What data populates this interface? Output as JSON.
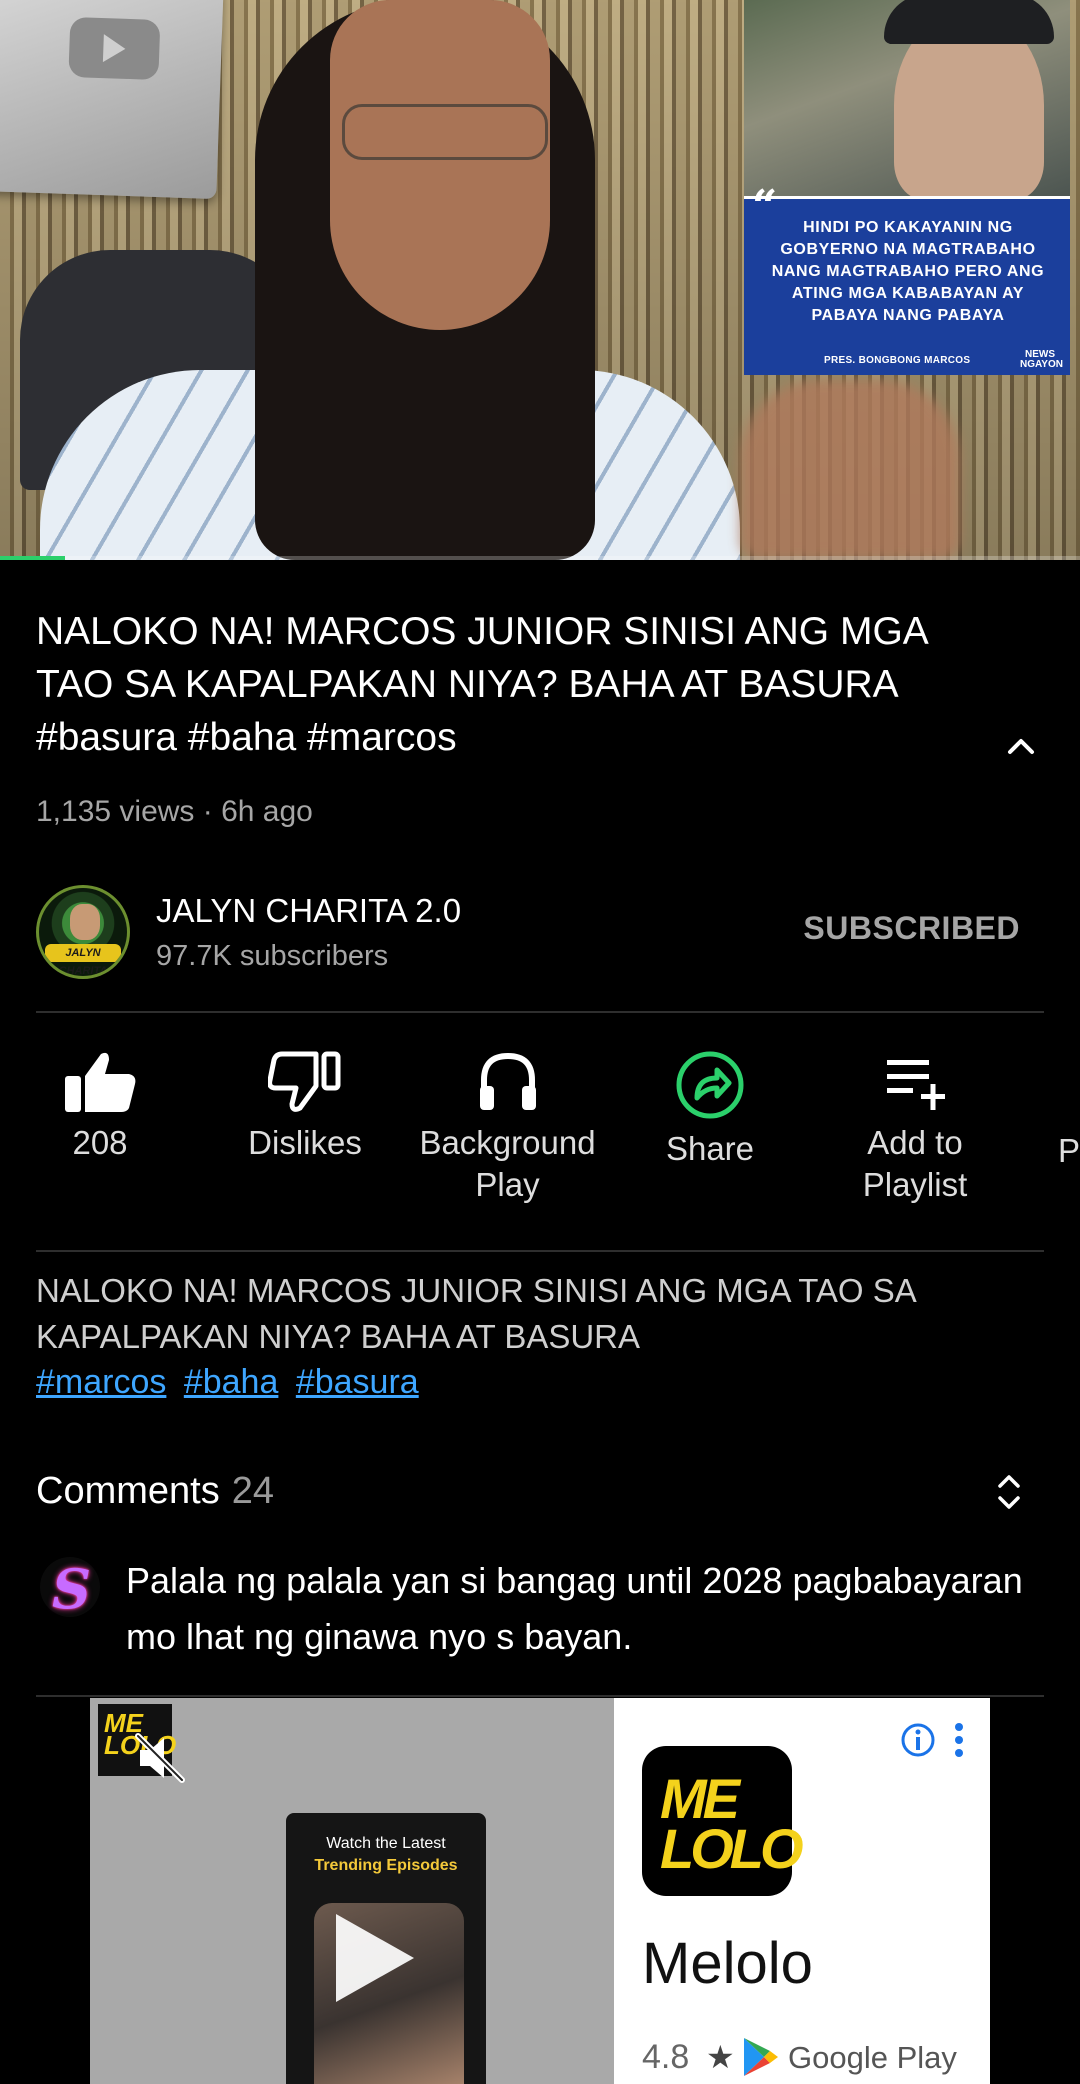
{
  "player": {
    "overlay_quote": "HINDI PO KAKAYANIN NG GOBYERNO NA MAGTRABAHO NANG MAGTRABAHO PERO ANG ATING MGA KABABAYAN AY PABAYA NANG PABAYA",
    "overlay_caption": "PRES. BONGBONG MARCOS",
    "overlay_logo": "NEWS NGAYON",
    "progress": 0.06,
    "progress_color": "#2bd06b"
  },
  "video": {
    "title": "NALOKO NA! MARCOS JUNIOR SINISI ANG MGA TAO SA KAPALPAKAN NIYA? BAHA AT BASURA #basura #baha #marcos",
    "meta": "1,135 views · 6h ago"
  },
  "channel": {
    "avatar_text": "JALYN CHARITA",
    "name": "JALYN CHARITA 2.0",
    "subscribers": "97.7K subscribers",
    "subscribe_label": "SUBSCRIBED"
  },
  "actions": {
    "like_count": "208",
    "dislike_label": "Dislikes",
    "background_play_label": "Background Play",
    "share_label": "Share",
    "add_playlist_label": "Add to Playlist",
    "more_label": "P",
    "share_color": "#2bd06b"
  },
  "description": {
    "text": "NALOKO NA! MARCOS JUNIOR SINISI ANG MGA TAO SA KAPALPAKAN NIYA? BAHA AT BASURA",
    "hashtags": [
      "#marcos",
      "#baha",
      "#basura"
    ],
    "link_color": "#3ea6ff"
  },
  "comments": {
    "title": "Comments",
    "count": "24",
    "first": {
      "avatar_letter": "S",
      "text": "Palala ng palala yan si bangag until 2028 pagbabayaran mo lhat ng ginawa nyo s bayan."
    }
  },
  "ad": {
    "small_logo": "ME LOLO",
    "phone_line1": "Watch the Latest",
    "phone_line2": "Trending Episodes",
    "app_icon_text": "ME LOLO",
    "app_name": "Melolo",
    "rating": "4.8",
    "store": "Google Play",
    "accent": "#f4d21c"
  },
  "icons": [
    "thumbs-up-icon",
    "thumbs-down-icon",
    "headphones-icon",
    "share-icon",
    "playlist-add-icon",
    "chevron-up-icon",
    "expand-icon",
    "mute-icon",
    "play-icon",
    "info-icon",
    "kebab-icon",
    "google-play-icon"
  ]
}
